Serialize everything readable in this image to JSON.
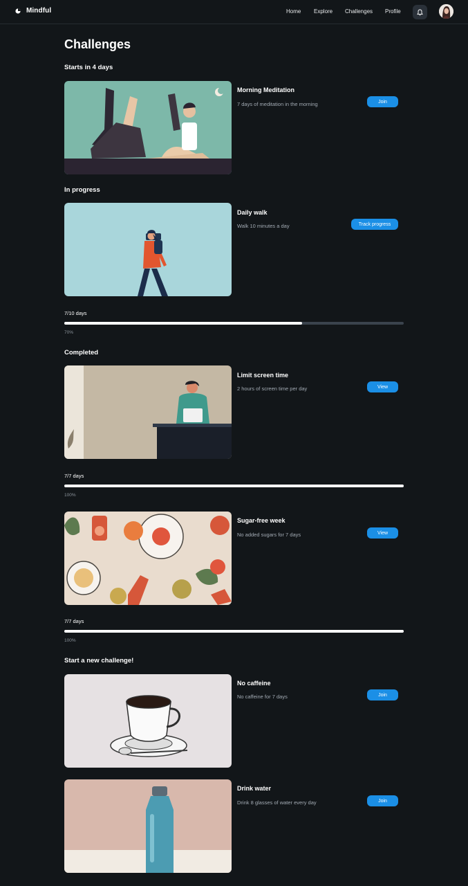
{
  "header": {
    "brand": "Mindful",
    "nav": [
      "Home",
      "Explore",
      "Challenges",
      "Profile"
    ],
    "icons": {
      "notifications": "bell-icon",
      "avatar": "user-avatar"
    }
  },
  "page": {
    "title": "Challenges"
  },
  "sections": {
    "upcoming": "Starts in 4 days",
    "in_progress": "In progress",
    "completed": "Completed",
    "new": "Start a new challenge!"
  },
  "cards": [
    {
      "title": "Morning Meditation",
      "description": "7 days of meditation in the morning",
      "action": "Join"
    },
    {
      "title": "Daily walk",
      "description": "Walk 10 minutes a day",
      "action": "Track progress",
      "progress_label": "7/10 days",
      "progress_pct": "70%",
      "progress": 0.7
    },
    {
      "title": "Limit screen time",
      "description": "2 hours of screen time per day",
      "action": "View",
      "progress_label": "7/7 days",
      "progress_pct": "100%",
      "progress": 1.0
    },
    {
      "title": "Sugar-free week",
      "description": "No added sugars for 7 days",
      "action": "View",
      "progress_label": "7/7 days",
      "progress_pct": "100%",
      "progress": 1.0
    },
    {
      "title": "No caffeine",
      "description": "No caffeine for 7 days",
      "action": "Join"
    },
    {
      "title": "Drink water",
      "description": "Drink 8 glasses of water every day",
      "action": "Join"
    }
  ],
  "colors": {
    "accent": "#1b8fe6",
    "background": "#121619",
    "muted_text": "#a3abb4"
  }
}
